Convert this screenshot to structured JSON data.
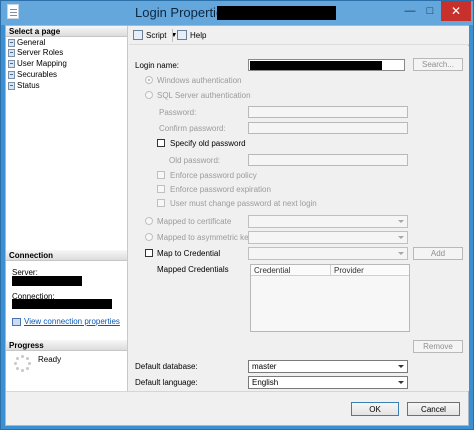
{
  "window": {
    "title": "Login Properties -"
  },
  "left_pane": {
    "select_page_heading": "Select a page",
    "pages": [
      {
        "label": "General"
      },
      {
        "label": "Server Roles"
      },
      {
        "label": "User Mapping"
      },
      {
        "label": "Securables"
      },
      {
        "label": "Status"
      }
    ],
    "connection_heading": "Connection",
    "server_label": "Server:",
    "connection_label": "Connection:",
    "view_connection_link": "View connection properties",
    "progress_heading": "Progress",
    "progress_status": "Ready"
  },
  "toolbar": {
    "script_label": "Script",
    "help_label": "Help"
  },
  "form": {
    "login_name_label": "Login name:",
    "search_button": "Search...",
    "windows_auth": "Windows authentication",
    "sql_auth": "SQL Server authentication",
    "password_label": "Password:",
    "confirm_password_label": "Confirm password:",
    "specify_old_password": "Specify old password",
    "old_password_label": "Old password:",
    "enforce_policy": "Enforce password policy",
    "enforce_expiration": "Enforce password expiration",
    "must_change": "User must change password at next login",
    "mapped_cert": "Mapped to certificate",
    "mapped_asym": "Mapped to asymmetric key",
    "map_credential": "Map to Credential",
    "add_button": "Add",
    "mapped_credentials_label": "Mapped Credentials",
    "grid_columns": [
      "Credential",
      "Provider"
    ],
    "remove_button": "Remove",
    "default_database_label": "Default database:",
    "default_database_value": "master",
    "default_language_label": "Default language:",
    "default_language_value": "English"
  },
  "buttons": {
    "ok": "OK",
    "cancel": "Cancel"
  }
}
